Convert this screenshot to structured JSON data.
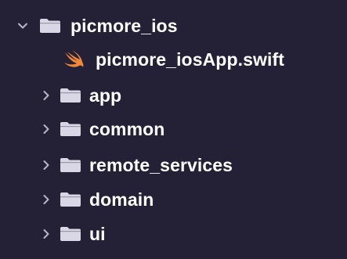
{
  "colors": {
    "background": "#242136",
    "folder": "#d9d6e6",
    "chevron": "#b9b5c6",
    "text": "#ffffff",
    "swift_orange": "#f0883a"
  },
  "tree": {
    "root": {
      "label": "picmore_ios",
      "icon": "folder-icon",
      "expanded": true
    },
    "file": {
      "label": "picmore_iosApp.swift",
      "icon": "swift-icon"
    },
    "children": [
      {
        "label": "app",
        "icon": "folder-icon",
        "expanded": false
      },
      {
        "label": "common",
        "icon": "folder-icon",
        "expanded": false
      },
      {
        "label": "remote_services",
        "icon": "folder-icon",
        "expanded": false
      },
      {
        "label": "domain",
        "icon": "folder-icon",
        "expanded": false
      },
      {
        "label": "ui",
        "icon": "folder-icon",
        "expanded": false
      }
    ]
  }
}
